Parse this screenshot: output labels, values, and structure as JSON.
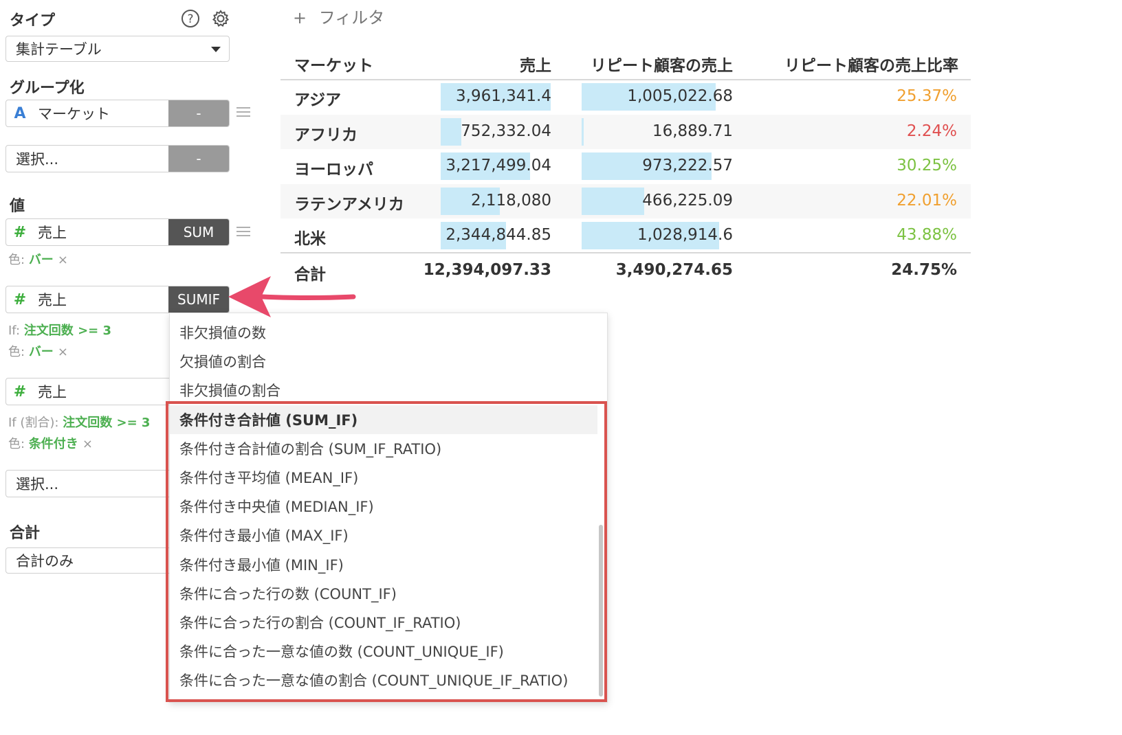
{
  "panel": {
    "type_label": "タイプ",
    "type_value": "集計テーブル",
    "group_label": "グループ化",
    "group_field": "マーケット",
    "group_field_icon": "A",
    "group_agg": "-",
    "group_select_placeholder": "選択...",
    "group_select_agg": "-",
    "value_label": "値",
    "values": [
      {
        "icon": "#",
        "field": "売上",
        "agg": "SUM",
        "color_prefix": "色:",
        "color_value": "バー"
      },
      {
        "icon": "#",
        "field": "売上",
        "agg": "SUMIF",
        "if_prefix": "If:",
        "if_value": "注文回数 >= 3",
        "color_prefix": "色:",
        "color_value": "バー"
      },
      {
        "icon": "#",
        "field": "売上",
        "if_prefix": "If (割合):",
        "if_value": "注文回数 >= 3",
        "color_prefix": "色:",
        "color_value": "条件付き"
      }
    ],
    "value_select_placeholder": "選択...",
    "total_label": "合計",
    "total_value": "合計のみ",
    "remove_glyph": "×"
  },
  "filter": {
    "plus": "+",
    "label": "フィルタ"
  },
  "table": {
    "headers": [
      "マーケット",
      "売上",
      "リピート顧客の売上",
      "リピート顧客の売上比率"
    ],
    "rows": [
      {
        "market": "アジア",
        "sales": "3,961,341.4",
        "sales_ratio": 1.0,
        "repeat": "1,005,022.68",
        "repeat_ratio": 0.977,
        "rate": "25.37%",
        "rate_color": "#f0a030"
      },
      {
        "market": "アフリカ",
        "sales": "752,332.04",
        "sales_ratio": 0.19,
        "repeat": "16,889.71",
        "repeat_ratio": 0.016,
        "rate": "2.24%",
        "rate_color": "#e05050"
      },
      {
        "market": "ヨーロッパ",
        "sales": "3,217,499.04",
        "sales_ratio": 0.812,
        "repeat": "973,222.57",
        "repeat_ratio": 0.946,
        "rate": "30.25%",
        "rate_color": "#7cc242"
      },
      {
        "market": "ラテンアメリカ",
        "sales": "2,118,080",
        "sales_ratio": 0.535,
        "repeat": "466,225.09",
        "repeat_ratio": 0.453,
        "rate": "22.01%",
        "rate_color": "#f0a030"
      },
      {
        "market": "北米",
        "sales": "2,344,844.85",
        "sales_ratio": 0.592,
        "repeat": "1,028,914.6",
        "repeat_ratio": 1.0,
        "rate": "43.88%",
        "rate_color": "#7cc242"
      }
    ],
    "total": {
      "label": "合計",
      "sales": "12,394,097.33",
      "repeat": "3,490,274.65",
      "rate": "24.75%"
    }
  },
  "dropdown": {
    "items": [
      "非欠損値の数",
      "欠損値の割合",
      "非欠損値の割合",
      "条件付き合計値 (SUM_IF)",
      "条件付き合計値の割合 (SUM_IF_RATIO)",
      "条件付き平均値 (MEAN_IF)",
      "条件付き中央値 (MEDIAN_IF)",
      "条件付き最小値 (MAX_IF)",
      "条件付き最小値 (MIN_IF)",
      "条件に合った行の数 (COUNT_IF)",
      "条件に合った行の割合 (COUNT_IF_RATIO)",
      "条件に合った一意な値の数 (COUNT_UNIQUE_IF)",
      "条件に合った一意な値の割合 (COUNT_UNIQUE_IF_RATIO)"
    ],
    "highlighted_index": 3
  },
  "colors": {
    "accent_red": "#d9534f",
    "arrow": "#e8496a",
    "bar": "#c9eaf8"
  }
}
